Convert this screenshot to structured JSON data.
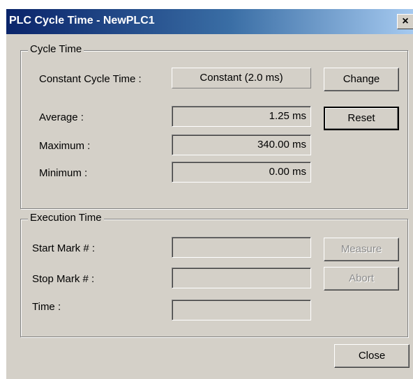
{
  "window": {
    "title": "PLC Cycle Time - NewPLC1",
    "close_glyph": "×"
  },
  "cycle_time": {
    "legend": "Cycle Time",
    "constant_label": "Constant Cycle Time :",
    "constant_value": "Constant (2.0 ms)",
    "change_button": "Change",
    "average_label": "Average :",
    "average_value": "1.25 ms",
    "reset_button": "Reset",
    "maximum_label": "Maximum :",
    "maximum_value": "340.00 ms",
    "minimum_label": "Minimum :",
    "minimum_value": "0.00 ms"
  },
  "execution_time": {
    "legend": "Execution Time",
    "start_label": "Start Mark # :",
    "start_value": "",
    "measure_button": "Measure",
    "stop_label": "Stop Mark # :",
    "stop_value": "",
    "abort_button": "Abort",
    "time_label": "Time :",
    "time_value": ""
  },
  "footer": {
    "close_button": "Close"
  }
}
